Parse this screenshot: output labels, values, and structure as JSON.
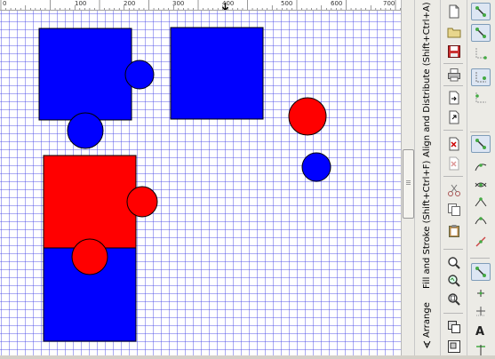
{
  "ruler": {
    "labels": [
      "0",
      "100",
      "200",
      "300",
      "400",
      "500",
      "600",
      "700"
    ]
  },
  "canvas": {
    "shapes": {
      "blue_fill": "#0000ff",
      "red_fill": "#ff0000",
      "stroke": "#000000"
    }
  },
  "dock": {
    "tabs": [
      {
        "label": "Align and Distribute (Shift+Ctrl+A)",
        "icon": "align-distribute-icon"
      },
      {
        "label": "Fill and Stroke (Shift+Ctrl+F)",
        "icon": "fill-stroke-icon"
      },
      {
        "label": "Arrange",
        "icon": "arrange-icon"
      }
    ]
  },
  "commands_bar": {
    "buttons": [
      {
        "icon": "new-document-icon"
      },
      {
        "icon": "open-folder-icon"
      },
      {
        "icon": "save-icon"
      },
      {
        "icon": "print-icon"
      },
      {
        "icon": "import-icon"
      },
      {
        "icon": "export-icon"
      },
      {
        "icon": "cut-icon"
      },
      {
        "icon": "copy-icon"
      },
      {
        "icon": "paste-icon"
      },
      {
        "icon": "zoom-icon"
      },
      {
        "icon": "zoom-drawing-icon"
      },
      {
        "icon": "zoom-page-icon"
      },
      {
        "icon": "duplicate-icon"
      },
      {
        "icon": "group-icon"
      }
    ]
  },
  "snap_bar": {
    "buttons": [
      {
        "icon": "snap-toggle-icon",
        "pressed": true
      },
      {
        "icon": "snap-bbox-icon",
        "pressed": true
      },
      {
        "icon": "snap-bbox-edge-icon",
        "pressed": false
      },
      {
        "icon": "snap-bbox-corner-icon",
        "pressed": true
      },
      {
        "icon": "snap-midpoint-icon",
        "pressed": false
      },
      {
        "icon": "snap-nodes-icon",
        "pressed": true
      },
      {
        "icon": "snap-path-icon",
        "pressed": false
      },
      {
        "icon": "snap-intersection-icon",
        "pressed": false
      },
      {
        "icon": "snap-cusp-icon",
        "pressed": false
      },
      {
        "icon": "snap-smooth-icon",
        "pressed": false
      },
      {
        "icon": "snap-center-icon",
        "pressed": true
      },
      {
        "icon": "snap-rotation-center-icon",
        "pressed": false
      },
      {
        "icon": "snap-page-border-icon",
        "pressed": false
      },
      {
        "icon": "snap-grid-icon",
        "pressed": false
      },
      {
        "icon": "text-baseline-icon",
        "pressed": false
      },
      {
        "icon": "snap-guide-icon",
        "pressed": false
      }
    ],
    "text_icon_label": "A"
  }
}
